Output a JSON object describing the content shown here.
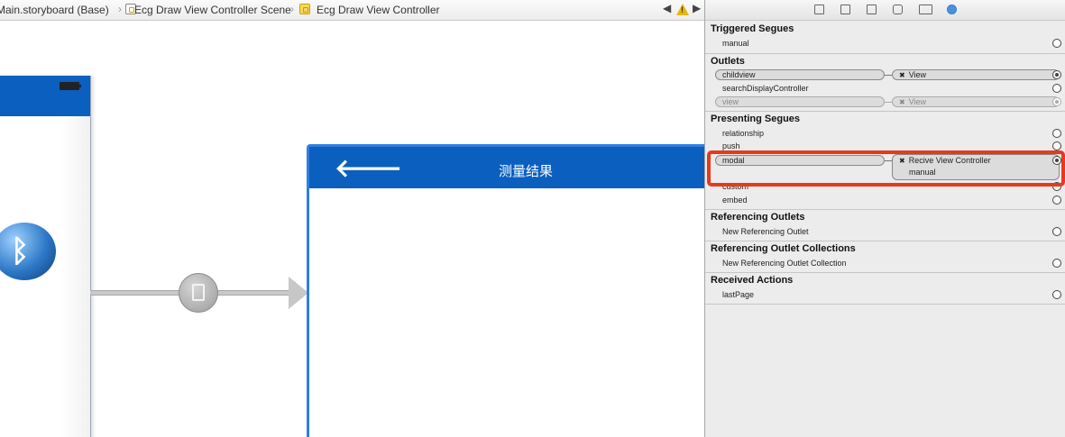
{
  "breadcrumb": {
    "file": "Main.storyboard (Base)",
    "scene": "Ecg Draw View Controller Scene",
    "controller": "Ecg Draw View Controller"
  },
  "canvas": {
    "second_vc_title": "测量结果",
    "back_arrow": "🡐",
    "bluetooth_glyph": "ᛒ"
  },
  "inspector": {
    "triggered_segues": {
      "title": "Triggered Segues",
      "items": [
        "manual"
      ]
    },
    "outlets": {
      "title": "Outlets",
      "items": [
        {
          "name": "childview",
          "target": "View"
        },
        {
          "name": "searchDisplayController",
          "target": ""
        },
        {
          "name": "view",
          "target": "View"
        }
      ]
    },
    "presenting_segues": {
      "title": "Presenting Segues",
      "items": [
        "relationship",
        "push",
        "modal",
        "custom",
        "embed"
      ],
      "modal_target": "Recive View Controller",
      "modal_target_sub": "manual"
    },
    "referencing_outlets": {
      "title": "Referencing Outlets",
      "items": [
        "New Referencing Outlet"
      ]
    },
    "referencing_collections": {
      "title": "Referencing Outlet Collections",
      "items": [
        "New Referencing Outlet Collection"
      ]
    },
    "received_actions": {
      "title": "Received Actions",
      "items": [
        "lastPage"
      ]
    }
  },
  "colors": {
    "navbar_blue": "#0a5fbf",
    "selection_blue": "#2f7fe0",
    "highlight_red": "#e53a1d",
    "warning_yellow": "#e9b600"
  }
}
